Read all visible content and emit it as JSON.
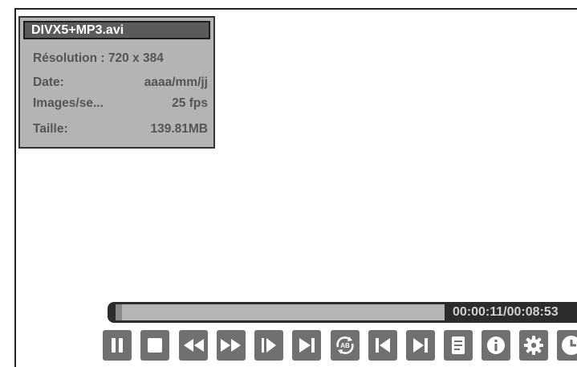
{
  "file": {
    "name": "DIVX5+MP3.avi",
    "resolution": "Résolution : 720 x 384",
    "date_label": "Date:",
    "date_value": "aaaa/mm/jj",
    "fps_label": "Images/se...",
    "fps_value": "25 fps",
    "size_label": "Taille:",
    "size_value": "139.81MB"
  },
  "playback": {
    "time": "00:00:11/00:08:53",
    "progress": 0.02
  },
  "controls": [
    {
      "name": "pause-button",
      "icon": "pause-icon"
    },
    {
      "name": "stop-button",
      "icon": "stop-icon"
    },
    {
      "name": "rewind-button",
      "icon": "rewind-icon"
    },
    {
      "name": "fast-forward-button",
      "icon": "fast-forward-icon"
    },
    {
      "name": "step-forward-button",
      "icon": "step-forward-icon"
    },
    {
      "name": "slow-play-button",
      "icon": "slow-play-icon"
    },
    {
      "name": "repeat-ab-button",
      "icon": "repeat-ab-icon",
      "label": "AB"
    },
    {
      "name": "previous-button",
      "icon": "previous-icon"
    },
    {
      "name": "next-button",
      "icon": "next-icon"
    },
    {
      "name": "subtitle-button",
      "icon": "document-icon"
    },
    {
      "name": "info-button",
      "icon": "info-icon"
    },
    {
      "name": "settings-button",
      "icon": "gear-icon"
    },
    {
      "name": "timer-button",
      "icon": "clock-icon"
    }
  ],
  "colors": {
    "panel_bg": "#b4b4b4",
    "title_bg": "#5b5b5b",
    "button_bg": "#707070",
    "progress_bg": "#2c2c2c"
  }
}
